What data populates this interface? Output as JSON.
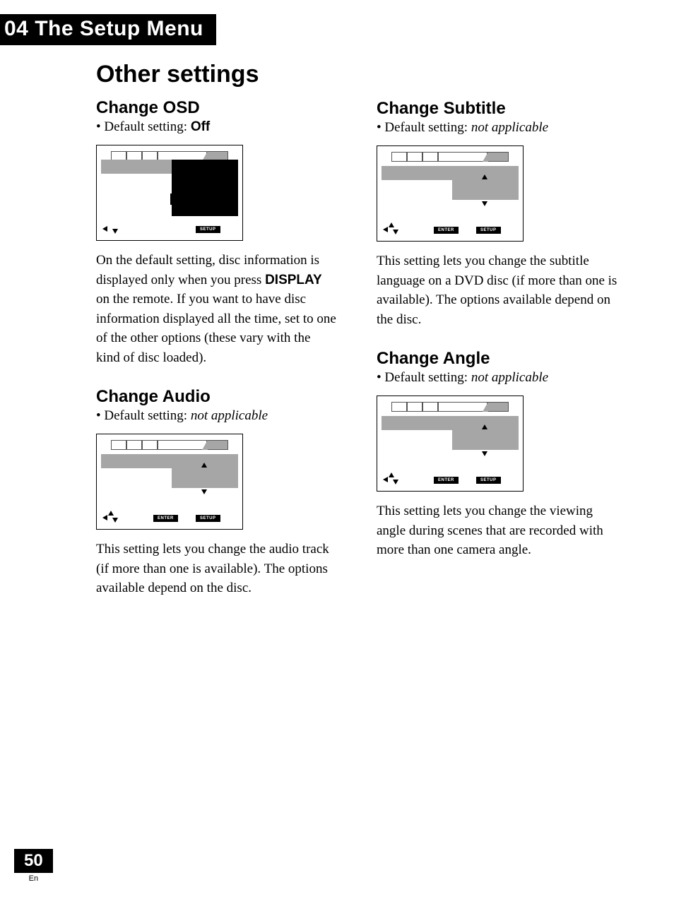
{
  "chapter": "04 The Setup Menu",
  "section_title": "Other settings",
  "left": {
    "osd": {
      "heading": "Change OSD",
      "default_label": "Default setting: ",
      "default_value": "Off",
      "para_part1": "On the default setting, disc information is displayed only when you press ",
      "para_bold": "DISPLAY",
      "para_part2": " on the remote. If you want to have disc information displayed all the time, set to one of the other options (these vary with the kind of disc loaded)."
    },
    "audio": {
      "heading": "Change Audio",
      "default_label": "Default setting: ",
      "default_value": "not applicable",
      "para": "This setting lets you change the audio track (if more than one is available). The options available depend on the disc."
    }
  },
  "right": {
    "subtitle": {
      "heading": "Change Subtitle",
      "default_label": "Default setting: ",
      "default_value": "not applicable",
      "para": "This setting lets you change the subtitle language on a DVD disc (if more than one is available). The options available depend on the disc."
    },
    "angle": {
      "heading": "Change Angle",
      "default_label": "Default setting: ",
      "default_value": "not applicable",
      "para": "This setting lets you change the viewing angle during scenes that are recorded with more than one camera angle."
    }
  },
  "buttons": {
    "enter": "ENTER",
    "setup": "SETUP"
  },
  "footer": {
    "page": "50",
    "lang": "En"
  }
}
